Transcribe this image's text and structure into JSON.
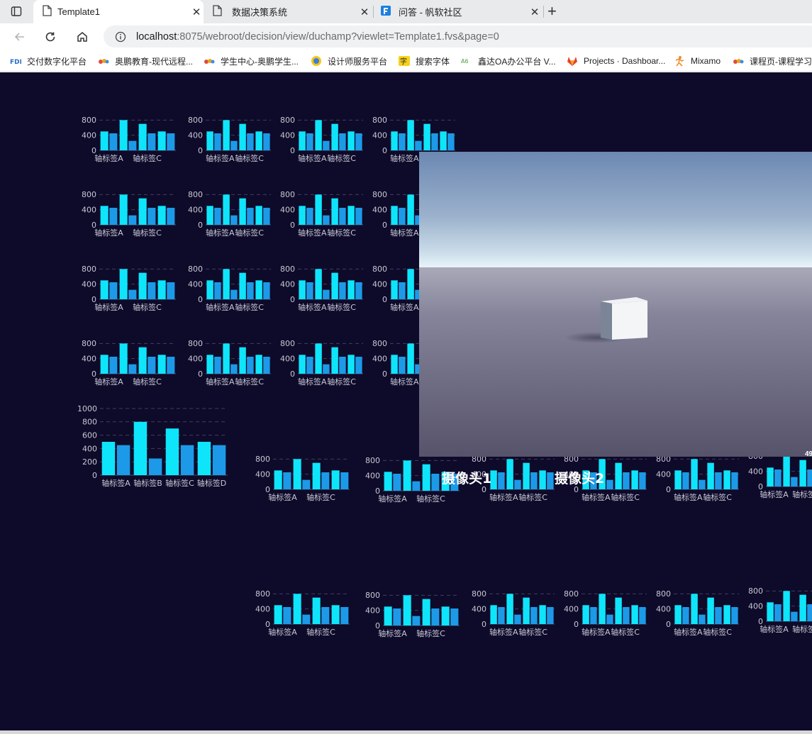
{
  "browser": {
    "tabs": [
      {
        "title": "Template1",
        "active": true,
        "icon": "page-icon"
      },
      {
        "title": "数据决策系统",
        "active": false,
        "icon": "page-icon"
      },
      {
        "title": "问答 - 帆软社区",
        "active": false,
        "icon": "fanruan-icon"
      }
    ],
    "new_tab_label": "+",
    "url_host": "localhost",
    "url_path": ":8075/webroot/decision/view/duchamp?viewlet=Template1.fvs&page=0",
    "bookmarks": [
      {
        "label": "交付数字化平台",
        "icon": "fdl-icon"
      },
      {
        "label": "奥鹏教育-现代远程...",
        "icon": "aopeng-icon"
      },
      {
        "label": "学生中心-奥鹏学生...",
        "icon": "aopeng-icon"
      },
      {
        "label": "设计师服务平台",
        "icon": "designer-icon"
      },
      {
        "label": "搜索字体",
        "icon": "font-icon"
      },
      {
        "label": "鑫达OA办公平台 V...",
        "icon": "oa-icon"
      },
      {
        "label": "Projects · Dashboar...",
        "icon": "gitlab-icon"
      },
      {
        "label": "Mixamo",
        "icon": "mixamo-icon"
      },
      {
        "label": "课程页-课程学习",
        "icon": "aopeng-icon"
      }
    ]
  },
  "dashboard": {
    "background": "#0e0a29",
    "camera_labels": [
      "摄像头1",
      "摄像头2"
    ],
    "partial_value_label": "49"
  },
  "colors": {
    "cyan": "#0ee5fb",
    "blue": "#1c9ae8",
    "axis_text": "#c8c8d6",
    "grid": "#3e3f63"
  },
  "chart_data": {
    "type": "bar",
    "categories": [
      "轴标签A",
      "轴标签B",
      "轴标签C",
      "轴标签D"
    ],
    "series": [
      {
        "values": [
          500,
          800,
          700,
          500
        ]
      },
      {
        "values": [
          450,
          250,
          450,
          450
        ]
      }
    ],
    "ylim": [
      0,
      1000
    ],
    "yticks": [
      0,
      200,
      400,
      600,
      800,
      1000
    ],
    "small_yticks": [
      0,
      400,
      800
    ]
  }
}
